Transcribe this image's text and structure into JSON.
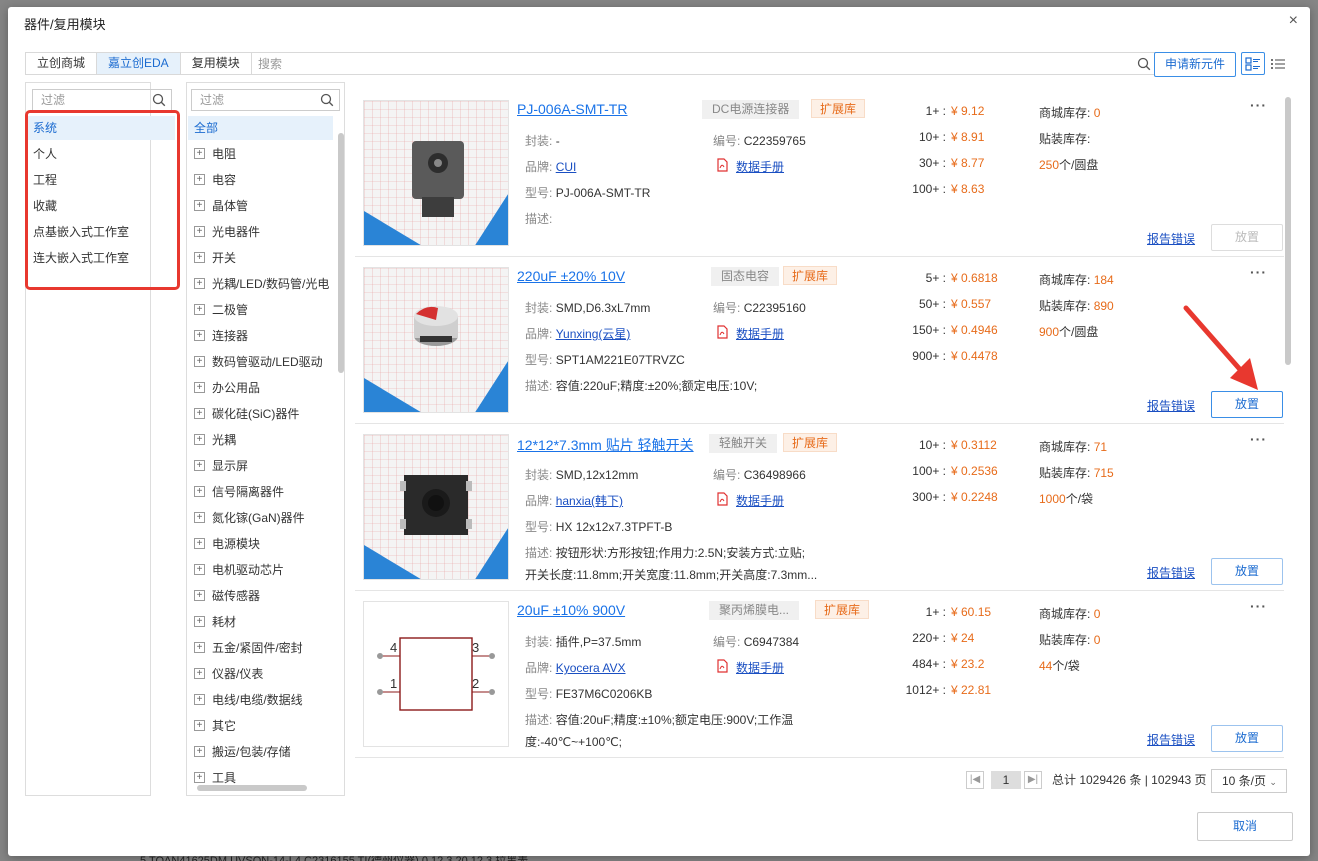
{
  "dialog": {
    "title": "器件/复用模块",
    "close": "×"
  },
  "top_tabs": [
    "立创商城",
    "嘉立创EDA",
    "复用模块"
  ],
  "search": {
    "placeholder": "搜索"
  },
  "apply_label": "申请新元件",
  "libs": {
    "filter_placeholder": "过滤",
    "items": [
      "系统",
      "个人",
      "工程",
      "收藏",
      "点基嵌入式工作室",
      "连大嵌入式工作室"
    ]
  },
  "cats": {
    "filter_placeholder": "过滤",
    "all": "全部",
    "items": [
      "电阻",
      "电容",
      "晶体管",
      "光电器件",
      "开关",
      "光耦/LED/数码管/光电",
      "二极管",
      "连接器",
      "数码管驱动/LED驱动",
      "办公用品",
      "碳化硅(SiC)器件",
      "光耦",
      "显示屏",
      "信号隔离器件",
      "氮化镓(GaN)器件",
      "电源模块",
      "电机驱动芯片",
      "磁传感器",
      "耗材",
      "五金/紧固件/密封",
      "仪器/仪表",
      "电线/电缆/数据线",
      "其它",
      "搬运/包装/存储",
      "工具"
    ]
  },
  "labels": {
    "package": "封装:",
    "brand": "品牌:",
    "model": "型号:",
    "desc": "描述:",
    "code": "编号:",
    "datasheet": "数据手册",
    "mall_stock": "商城库存:",
    "smt_stock": "贴装库存:",
    "report": "报告错误",
    "place": "放置",
    "lib_tag": "扩展库",
    "more": "···"
  },
  "parts": [
    {
      "name": "PJ-006A-SMT-TR",
      "category": "DC电源连接器",
      "package": "-",
      "code": "C22359765",
      "brand": "CUI",
      "model": "PJ-006A-SMT-TR",
      "desc1": "",
      "desc2": "",
      "tiers": [
        "1+ :",
        "10+ :",
        "30+ :",
        "100+ :"
      ],
      "prices": [
        "¥ 9.12",
        "¥ 8.91",
        "¥ 8.77",
        "¥ 8.63"
      ],
      "mall_stock": "0",
      "smt_stock": "",
      "pack_qty": "250",
      "pack_unit": "个/圆盘"
    },
    {
      "name": "220uF ±20% 10V",
      "category": "固态电容",
      "package": "SMD,D6.3xL7mm",
      "code": "C22395160",
      "brand": "Yunxing(云星)",
      "model": "SPT1AM221E07TRVZC",
      "desc1": "容值:220uF;精度:±20%;额定电压:10V;",
      "desc2": "",
      "tiers": [
        "5+ :",
        "50+ :",
        "150+ :",
        "900+ :"
      ],
      "prices": [
        "¥ 0.6818",
        "¥ 0.557",
        "¥ 0.4946",
        "¥ 0.4478"
      ],
      "mall_stock": "184",
      "smt_stock": "890",
      "pack_qty": "900",
      "pack_unit": "个/圆盘"
    },
    {
      "name": "12*12*7.3mm 贴片 轻触开关",
      "category": "轻触开关",
      "package": "SMD,12x12mm",
      "code": "C36498966",
      "brand": "hanxia(韩下)",
      "model": "HX 12x12x7.3TPFT-B",
      "desc1": "按钮形状:方形按钮;作用力:2.5N;安装方式:立贴;",
      "desc2": "开关长度:11.8mm;开关宽度:11.8mm;开关高度:7.3mm...",
      "tiers": [
        "10+ :",
        "100+ :",
        "300+ :"
      ],
      "prices": [
        "¥ 0.3112",
        "¥ 0.2536",
        "¥ 0.2248"
      ],
      "mall_stock": "71",
      "smt_stock": "715",
      "pack_qty": "1000",
      "pack_unit": "个/袋"
    },
    {
      "name": "20uF ±10% 900V",
      "category": "聚丙烯膜电...",
      "package": "插件,P=37.5mm",
      "code": "C6947384",
      "brand": "Kyocera AVX",
      "model": "FE37M6C0206KB",
      "desc1": "容值:20uF;精度:±10%;额定电压:900V;工作温",
      "desc2": "度:-40℃~+100℃;",
      "tiers": [
        "1+ :",
        "220+ :",
        "484+ :",
        "1012+ :"
      ],
      "prices": [
        "¥ 60.15",
        "¥ 24",
        "¥ 23.2",
        "¥ 22.81"
      ],
      "mall_stock": "0",
      "smt_stock": "0",
      "pack_qty": "44",
      "pack_unit": "个/袋",
      "pins": [
        "4",
        "3",
        "1",
        "2"
      ]
    }
  ],
  "pager": {
    "current": "1",
    "summary": "总计 1029426 条 | 102943 页",
    "size": "10 条/页"
  },
  "cancel_label": "取消",
  "bg_row": "5      TOAN41625DM      UVSON-14-L4             C2316155          TI(德州仪器)        0                        12.3                    20                  12.3          拉黑表",
  "colors": {
    "accent": "#1b6bd0",
    "price": "#e76b1a",
    "annotation": "#e8382f"
  }
}
